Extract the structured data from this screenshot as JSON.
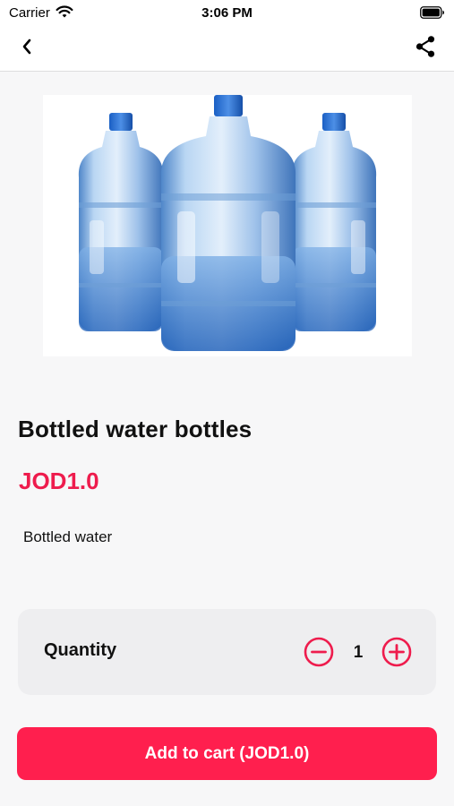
{
  "status_bar": {
    "carrier": "Carrier",
    "time": "3:06 PM",
    "wifi_icon": "wifi-icon",
    "battery_icon": "battery-icon"
  },
  "nav": {
    "back_icon": "chevron-left-icon",
    "share_icon": "share-icon"
  },
  "product": {
    "image_icon": "water-bottles-image",
    "title": "Bottled water bottles",
    "price": "JOD1.0",
    "description": "Bottled water"
  },
  "quantity": {
    "label": "Quantity",
    "value": "1",
    "minus_icon": "minus-circle-icon",
    "plus_icon": "plus-circle-icon"
  },
  "cart": {
    "button_label": "Add to cart (JOD1.0)"
  },
  "colors": {
    "accent": "#ff1f4e",
    "price": "#ee1c4d",
    "background": "#f7f7f8",
    "card": "#eeeef0"
  }
}
